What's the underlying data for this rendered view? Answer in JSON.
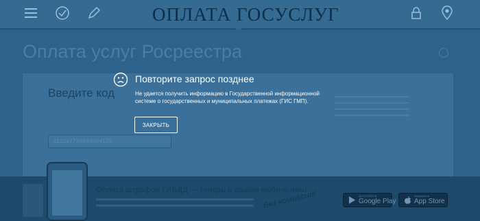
{
  "header": {
    "brand": "ОПЛАТА ГОСУСЛУГ",
    "icons": [
      "menu-icon",
      "checkmark-icon",
      "pen-icon",
      "lock-icon",
      "location-pin-icon"
    ]
  },
  "page": {
    "title": "Оплата услуг Росреестра",
    "form_heading": "Введите код",
    "code_value": "321367729883404155"
  },
  "promo": {
    "title": "Оплата штрафов ГИБДД — теперь в вашем мобильном!",
    "stamp": "Без комиссии!",
    "google_play": {
      "caption": "ДОСТУПНО В",
      "name": "Google Play"
    },
    "app_store": {
      "caption": "Загрузите в",
      "name": "App Store"
    }
  },
  "modal": {
    "title": "Повторите запрос позднее",
    "message": "Не удается получить информацию в Государственной информационной системе о государственных и муниципальных платежах (ГИС ГМП).",
    "close_label": "ЗАКРЫТЬ"
  },
  "colors": {
    "overlay_bg": "#1f4a6d",
    "modal_text": "#ffffff"
  }
}
